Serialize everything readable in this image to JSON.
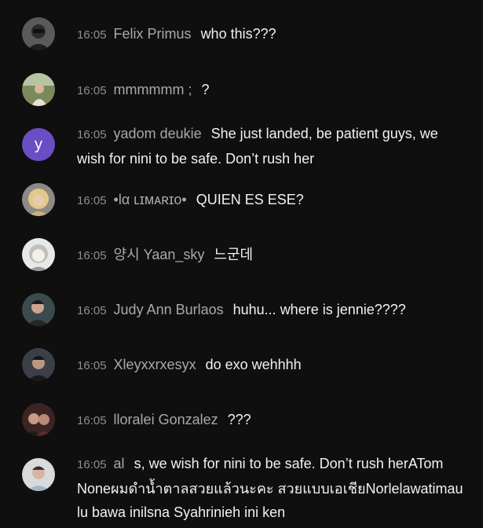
{
  "messages": [
    {
      "time": "16:05",
      "author": "Felix Primus",
      "text": "who this???",
      "avatar": "photo-dark-man-icon"
    },
    {
      "time": "16:05",
      "author": "mmmmmm ;",
      "text": "?",
      "avatar": "photo-outdoor-icon"
    },
    {
      "time": "16:05",
      "author": "yadom deukie",
      "text": "She just landed, be patient guys, we wish for nini to be safe. Don’t rush her",
      "avatar": "letter-avatar-icon",
      "avatar_letter": "y",
      "avatar_color": "#6a4fc4"
    },
    {
      "time": "16:05",
      "author": "•lα ʟɪᴍᴀʀɪᴏ•",
      "text": "QUIEN ES ESE?",
      "avatar": "photo-blonde-icon"
    },
    {
      "time": "16:05",
      "author": "양시 Yaan_sky",
      "text": "느군데",
      "avatar": "photo-anime-icon"
    },
    {
      "time": "16:05",
      "author": "Judy Ann Burlaos",
      "text": "huhu... where is jennie????",
      "avatar": "photo-person-icon"
    },
    {
      "time": "16:05",
      "author": "Xleyxxrxesyx",
      "text": "do exo wehhhh",
      "avatar": "photo-person-dark-icon"
    },
    {
      "time": "16:05",
      "author": "lloralei Gonzalez",
      "text": "???",
      "avatar": "photo-two-people-icon"
    },
    {
      "time": "16:05",
      "author": "al",
      "text": "s, we wish for nini to be safe. Don’t rush herATom Noneผมดำน้ำตาลสวยแล้วนะคะ สวยแบบเอเชียNorlelawatimau lu bawa inilsna Syahrinieh ini ken",
      "avatar": "photo-person-light-icon"
    }
  ]
}
